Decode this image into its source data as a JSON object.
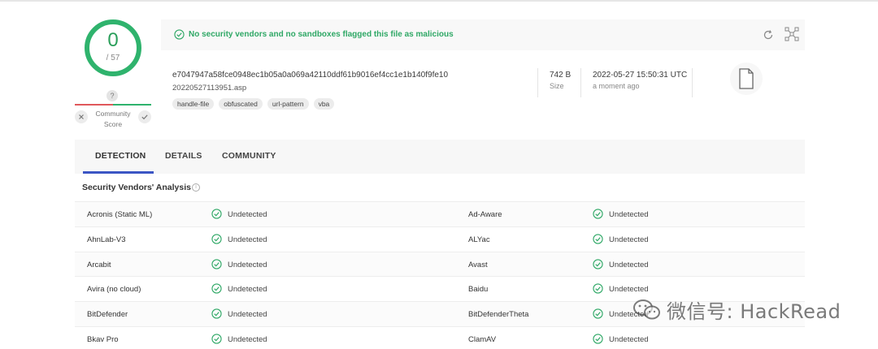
{
  "score": {
    "value": "0",
    "total": "/ 57",
    "community_label": "Community Score",
    "community_unknown": "?"
  },
  "banner": {
    "message": "No security vendors and no sandboxes flagged this file as malicious"
  },
  "file": {
    "hash": "e7047947a58fce0948ec1b05a0a069a42110ddf61b9016ef4cc1e1b140f9fe10",
    "name": "20220527113951.asp",
    "tags": [
      "handle-file",
      "obfuscated",
      "url-pattern",
      "vba"
    ],
    "size_value": "742 B",
    "size_label": "Size",
    "date_value": "2022-05-27 15:50:31 UTC",
    "date_label": "a moment ago"
  },
  "tabs": [
    {
      "label": "DETECTION",
      "active": true
    },
    {
      "label": "DETAILS",
      "active": false
    },
    {
      "label": "COMMUNITY",
      "active": false
    }
  ],
  "section": {
    "title": "Security Vendors' Analysis"
  },
  "vendors": [
    {
      "left": "Acronis (Static ML)",
      "left_result": "Undetected",
      "right": "Ad-Aware",
      "right_result": "Undetected"
    },
    {
      "left": "AhnLab-V3",
      "left_result": "Undetected",
      "right": "ALYac",
      "right_result": "Undetected"
    },
    {
      "left": "Arcabit",
      "left_result": "Undetected",
      "right": "Avast",
      "right_result": "Undetected"
    },
    {
      "left": "Avira (no cloud)",
      "left_result": "Undetected",
      "right": "Baidu",
      "right_result": "Undetected"
    },
    {
      "left": "BitDefender",
      "left_result": "Undetected",
      "right": "BitDefenderTheta",
      "right_result": "Undetected"
    },
    {
      "left": "Bkav Pro",
      "left_result": "Undetected",
      "right": "ClamAV",
      "right_result": "Undetected"
    }
  ],
  "watermark": {
    "text": "微信号: HackRead"
  },
  "colors": {
    "accent_green": "#2fa866",
    "tab_accent": "#3b55c4",
    "community_negative": "#e0585b"
  }
}
